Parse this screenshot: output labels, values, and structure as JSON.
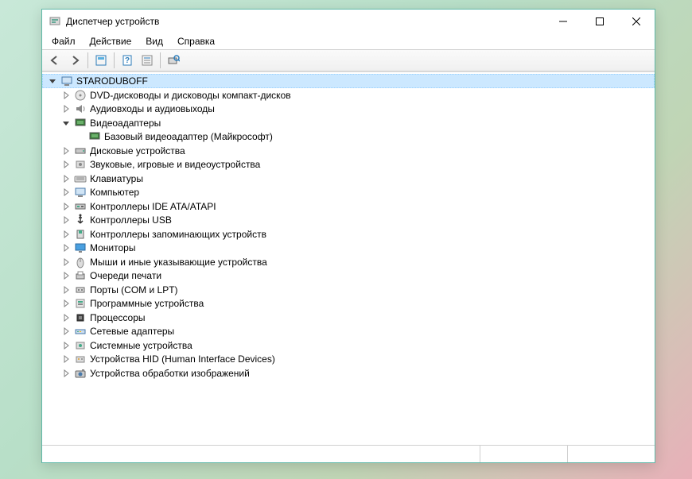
{
  "window": {
    "title": "Диспетчер устройств"
  },
  "menu": {
    "file": "Файл",
    "action": "Действие",
    "view": "Вид",
    "help": "Справка"
  },
  "tree": {
    "root": "STARODUBOFF",
    "items": [
      {
        "label": "DVD-дисководы и дисководы компакт-дисков",
        "expanded": false
      },
      {
        "label": "Аудиовходы и аудиовыходы",
        "expanded": false
      },
      {
        "label": "Видеоадаптеры",
        "expanded": true,
        "children": [
          {
            "label": "Базовый видеоадаптер (Майкрософт)"
          }
        ]
      },
      {
        "label": "Дисковые устройства",
        "expanded": false
      },
      {
        "label": "Звуковые, игровые и видеоустройства",
        "expanded": false
      },
      {
        "label": "Клавиатуры",
        "expanded": false
      },
      {
        "label": "Компьютер",
        "expanded": false
      },
      {
        "label": "Контроллеры IDE ATA/ATAPI",
        "expanded": false
      },
      {
        "label": "Контроллеры USB",
        "expanded": false
      },
      {
        "label": "Контроллеры запоминающих устройств",
        "expanded": false
      },
      {
        "label": "Мониторы",
        "expanded": false
      },
      {
        "label": "Мыши и иные указывающие устройства",
        "expanded": false
      },
      {
        "label": "Очереди печати",
        "expanded": false
      },
      {
        "label": "Порты (COM и LPT)",
        "expanded": false
      },
      {
        "label": "Программные устройства",
        "expanded": false
      },
      {
        "label": "Процессоры",
        "expanded": false
      },
      {
        "label": "Сетевые адаптеры",
        "expanded": false
      },
      {
        "label": "Системные устройства",
        "expanded": false
      },
      {
        "label": "Устройства HID (Human Interface Devices)",
        "expanded": false
      },
      {
        "label": "Устройства обработки изображений",
        "expanded": false
      }
    ]
  },
  "icons": {
    "root": "computer",
    "category": [
      "disc",
      "audio",
      "display",
      "drive",
      "sound",
      "keyboard",
      "computer",
      "ide",
      "usb",
      "storage",
      "monitor",
      "mouse",
      "printer",
      "port",
      "software",
      "cpu",
      "network",
      "system",
      "hid",
      "imaging"
    ]
  }
}
